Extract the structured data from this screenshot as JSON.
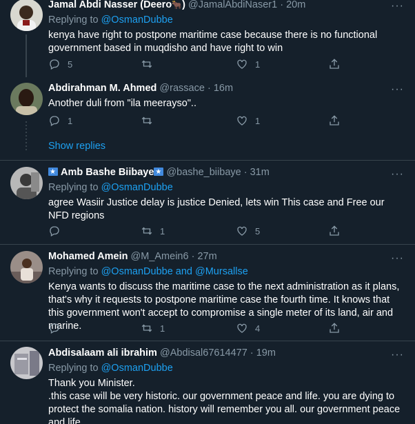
{
  "tweets": [
    {
      "name": "Jamal Abdi Nasser (Deero",
      "name_suffix": ")",
      "handle": "@JamalAbdiNaser1",
      "time": "20m",
      "replying_label": "Replying to",
      "replying_to": "@OsmanDubbe",
      "text": "kenya have right to postpone maritime case because there is no functional government based in muqdisho and have right to win",
      "replies": "5",
      "retweets": "",
      "likes": "1"
    },
    {
      "name": "Abdirahman M. Ahmed",
      "handle": "@rassace",
      "time": "16m",
      "text": "Another duli from \"ila meerayso\"..",
      "replies": "1",
      "retweets": "",
      "likes": "1"
    },
    {
      "show_replies": "Show replies"
    },
    {
      "name": "Amb Bashe Biibaye",
      "handle": "@bashe_biibaye",
      "time": "31m",
      "replying_label": "Replying to",
      "replying_to": "@OsmanDubbe",
      "text": "agree Wasiir Justice delay is justice Denied, lets win This case and Free our NFD regions",
      "replies": "",
      "retweets": "1",
      "likes": "5"
    },
    {
      "name": "Mohamed Amein",
      "handle": "@M_Amein6",
      "time": "27m",
      "replying_label": "Replying to",
      "replying_to": "@OsmanDubbe and @Mursallse",
      "text": "Kenya wants to discuss the maritime case to the next administration as it plans, that's why it requests to postpone maritime case the fourth time. It knows that this government won't accept to compromise a single meter of its land, air and marine.",
      "replies": "",
      "retweets": "1",
      "likes": "4"
    },
    {
      "name": "Abdisalaam ali ibrahim",
      "handle": "@Abdisal67614477",
      "time": "19m",
      "replying_label": "Replying to",
      "replying_to": "@OsmanDubbe",
      "text_line1": "Thank you Minister.",
      "text_line2": ".this case will be very historic. our government peace and life. you are dying to protect the somalia nation. history will remember you all. our government peace and life."
    }
  ],
  "dot": "·",
  "more_glyph": "···",
  "icons": [
    "reply-icon",
    "retweet-icon",
    "like-icon",
    "share-icon",
    "more-icon"
  ],
  "colors": {
    "background": "#15202b",
    "link": "#1da1f2",
    "muted": "#8899a6",
    "divider": "#38444d"
  }
}
